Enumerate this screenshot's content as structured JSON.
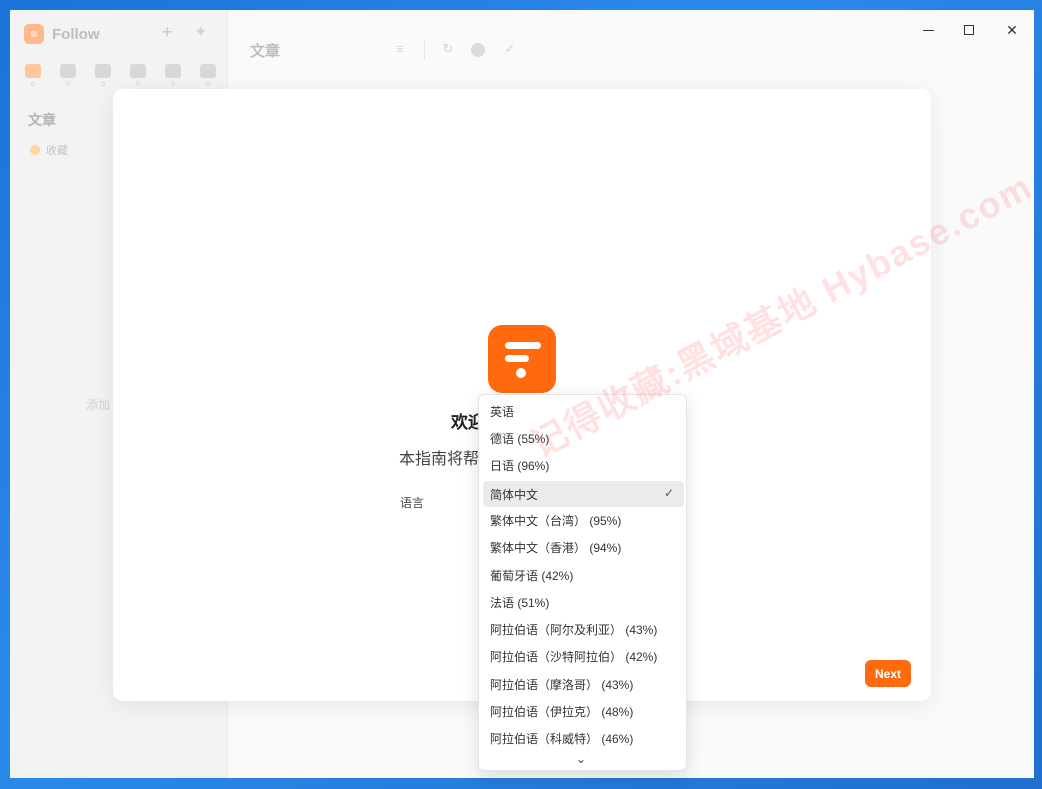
{
  "app": {
    "name": "Follow"
  },
  "sidebar": {
    "section_title": "文章",
    "favorites_label": "收藏",
    "add_hint": "添加",
    "categories": [
      {
        "icon": "article-icon",
        "count": "0"
      },
      {
        "icon": "social-icon",
        "count": "0"
      },
      {
        "icon": "picture-icon",
        "count": "0"
      },
      {
        "icon": "video-icon",
        "count": "0"
      },
      {
        "icon": "audio-icon",
        "count": "0"
      },
      {
        "icon": "notification-icon",
        "count": "0"
      }
    ]
  },
  "main": {
    "header_title": "文章"
  },
  "onboarding": {
    "title": "欢迎",
    "description": "本指南将帮",
    "language_label": "语言",
    "next_label": "Next"
  },
  "language_dropdown": {
    "selected": "简体中文",
    "options": [
      {
        "label": "英语",
        "selected": false
      },
      {
        "label": "德语 (55%)",
        "selected": false
      },
      {
        "label": "日语 (96%)",
        "selected": false
      },
      {
        "label": "简体中文",
        "selected": true
      },
      {
        "label": "繁体中文（台湾） (95%)",
        "selected": false
      },
      {
        "label": "繁体中文（香港） (94%)",
        "selected": false
      },
      {
        "label": "葡萄牙语 (42%)",
        "selected": false
      },
      {
        "label": "法语 (51%)",
        "selected": false
      },
      {
        "label": "阿拉伯语（阿尔及利亚） (43%)",
        "selected": false
      },
      {
        "label": "阿拉伯语（沙特阿拉伯） (42%)",
        "selected": false
      },
      {
        "label": "阿拉伯语（摩洛哥） (43%)",
        "selected": false
      },
      {
        "label": "阿拉伯语（伊拉克） (48%)",
        "selected": false
      },
      {
        "label": "阿拉伯语（科威特） (46%)",
        "selected": false
      }
    ]
  },
  "watermark": {
    "text": "记得收藏:黑域基地 Hybase.com"
  },
  "colors": {
    "accent": "#ff6a0f",
    "selected_bg": "#ebebeb"
  }
}
